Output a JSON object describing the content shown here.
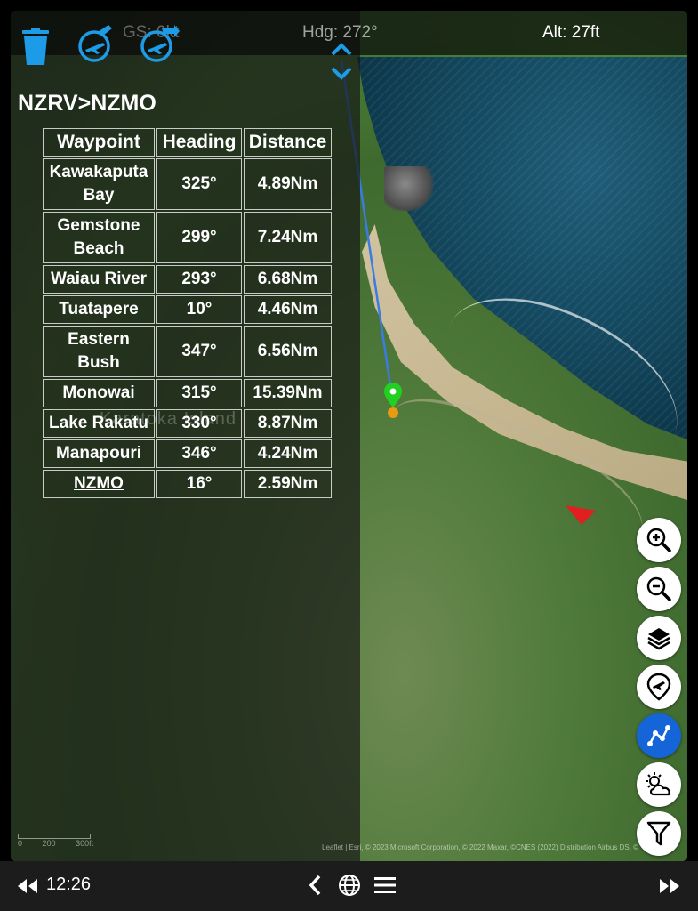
{
  "topbar": {
    "speed": "GS: 0kt",
    "heading": "Hdg: 272°",
    "altitude": "Alt: 27ft"
  },
  "route": {
    "title": "NZRV>NZMO",
    "columns": [
      "Waypoint",
      "Heading",
      "Distance"
    ],
    "rows": [
      {
        "name": "Kawakaputa Bay",
        "heading": "325°",
        "distance": "4.89Nm"
      },
      {
        "name": "Gemstone Beach",
        "heading": "299°",
        "distance": "7.24Nm"
      },
      {
        "name": "Waiau River",
        "heading": "293°",
        "distance": "6.68Nm"
      },
      {
        "name": "Tuatapere",
        "heading": "10°",
        "distance": "4.46Nm"
      },
      {
        "name": "Eastern Bush",
        "heading": "347°",
        "distance": "6.56Nm"
      },
      {
        "name": "Monowai",
        "heading": "315°",
        "distance": "15.39Nm"
      },
      {
        "name": "Lake Rakatu",
        "heading": "330°",
        "distance": "8.87Nm"
      },
      {
        "name": "Manapouri",
        "heading": "346°",
        "distance": "4.24Nm"
      },
      {
        "name": "NZMO",
        "heading": "16°",
        "distance": "2.59Nm"
      }
    ]
  },
  "map": {
    "label": "Karatoka Island",
    "attribution": "Leaflet | Esri, © 2023 Microsoft Corporation, © 2022 Maxar, ©CNES (2022) Distribution Airbus DS, ©",
    "scale_labels": [
      "0",
      "200",
      "300ft"
    ]
  },
  "bottombar": {
    "time": "12:26"
  },
  "colors": {
    "accent": "#1e9be6",
    "active_button": "#1565d8",
    "marker_green": "#22d022",
    "marker_orange": "#e89a12",
    "aircraft_red": "#e02020"
  }
}
